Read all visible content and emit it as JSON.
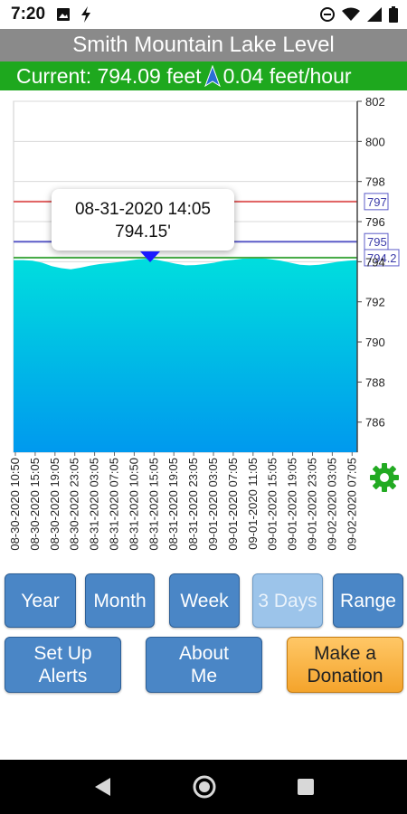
{
  "status_bar": {
    "time": "7:20",
    "left_icons": [
      "image-icon",
      "flash-icon"
    ],
    "right_icons": [
      "do-not-disturb-icon",
      "wifi-icon",
      "signal-icon",
      "battery-icon"
    ]
  },
  "header": {
    "title": "Smith Mountain Lake Level",
    "current": "Current: 794.09 feet",
    "rate": "0.04 feet/hour",
    "rate_direction_icon": "up-arrow-icon"
  },
  "tooltip": {
    "datetime": "08-31-2020 14:05",
    "value": "794.15'"
  },
  "chart_data": {
    "type": "area",
    "title": "",
    "ylim": [
      784.5,
      802
    ],
    "y_ticks": [
      "802",
      "800",
      "798",
      "796",
      "794",
      "792",
      "790",
      "788",
      "786"
    ],
    "x_tick_labels": [
      "08-30-2020 10:50",
      "08-30-2020 15:05",
      "08-30-2020 19:05",
      "08-30-2020 23:05",
      "08-31-2020 03:05",
      "08-31-2020 07:05",
      "08-31-2020 10:50",
      "08-31-2020 15:05",
      "08-31-2020 19:05",
      "08-31-2020 23:05",
      "09-01-2020 03:05",
      "09-01-2020 07:05",
      "09-01-2020 11:05",
      "09-01-2020 15:05",
      "09-01-2020 19:05",
      "09-01-2020 23:05",
      "09-02-2020 03:05",
      "09-02-2020 07:05"
    ],
    "reference_lines": [
      {
        "value": 797,
        "label": "797",
        "color": "#e06060"
      },
      {
        "value": 795,
        "label": "795",
        "color": "#5c5cc8"
      },
      {
        "value": 794.2,
        "label": "794.2",
        "color": "#44aa44"
      }
    ],
    "series": [
      {
        "values": [
          794.08,
          794.08,
          794.05,
          793.95,
          793.78,
          793.68,
          793.62,
          793.7,
          793.8,
          793.88,
          793.93,
          793.98,
          794.05,
          794.12,
          794.15,
          794.1,
          794.0,
          793.9,
          793.82,
          793.83,
          793.88,
          793.95,
          794.05,
          794.1,
          794.15,
          794.18,
          794.18,
          794.12,
          794.05,
          793.95,
          793.85,
          793.82,
          793.85,
          793.92,
          794.0,
          794.05,
          794.08
        ]
      }
    ],
    "colors": {
      "area_top": "#00dede",
      "area_bottom": "#0099ee",
      "marker": "#1a1aff"
    }
  },
  "buttons": {
    "year": "Year",
    "month": "Month",
    "week": "Week",
    "three_days": "3 Days",
    "range": "Range",
    "alerts_line1": "Set Up",
    "alerts_line2": "Alerts",
    "about_line1": "About",
    "about_line2": "Me",
    "donate_line1": "Make a",
    "donate_line2": "Donation"
  },
  "nav": {
    "back_icon": "back-icon",
    "home_icon": "home-icon",
    "recents_icon": "recents-icon"
  }
}
